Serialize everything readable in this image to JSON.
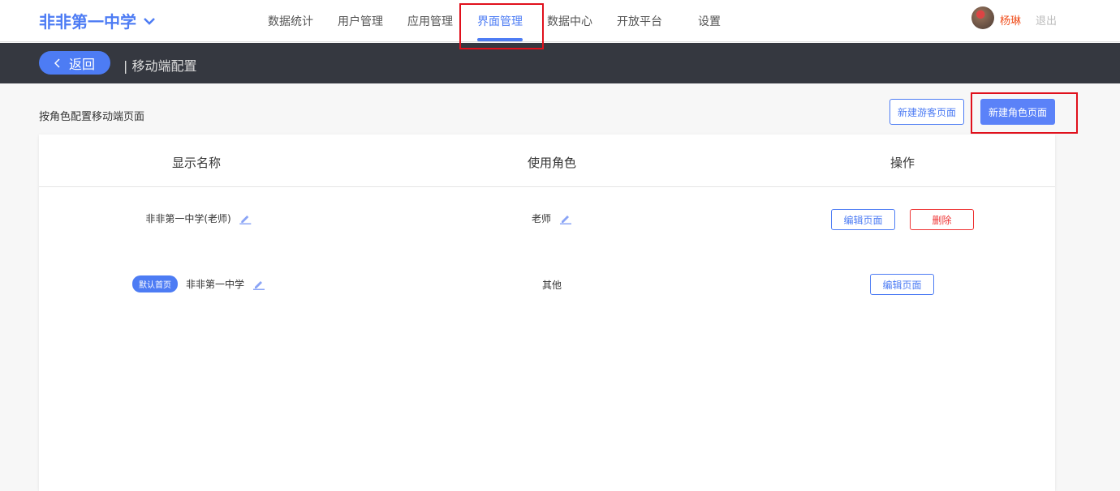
{
  "header": {
    "school": "非非第一中学",
    "nav": [
      "数据统计",
      "用户管理",
      "应用管理",
      "界面管理",
      "数据中心",
      "开放平台",
      "设置"
    ],
    "active": "界面管理",
    "user": "杨琳",
    "logout": "退出"
  },
  "subbar": {
    "back": "返回",
    "breadcrumb": "| 移动端配置"
  },
  "section": {
    "title": "按角色配置移动端页面",
    "new_guest": "新建游客页面",
    "new_role": "新建角色页面"
  },
  "table": {
    "headers": [
      "显示名称",
      "使用角色",
      "操作"
    ],
    "rows": [
      {
        "name": "非非第一中学(老师)",
        "role": "老师",
        "actions": [
          "编辑页面",
          "删除"
        ]
      },
      {
        "badge": "默认首页",
        "name": "非非第一中学",
        "role": "其他",
        "actions": [
          "编辑页面"
        ]
      }
    ]
  },
  "colors": {
    "accent": "#4d7cf4",
    "danger": "#e33333",
    "highlight": "#e0101c"
  }
}
